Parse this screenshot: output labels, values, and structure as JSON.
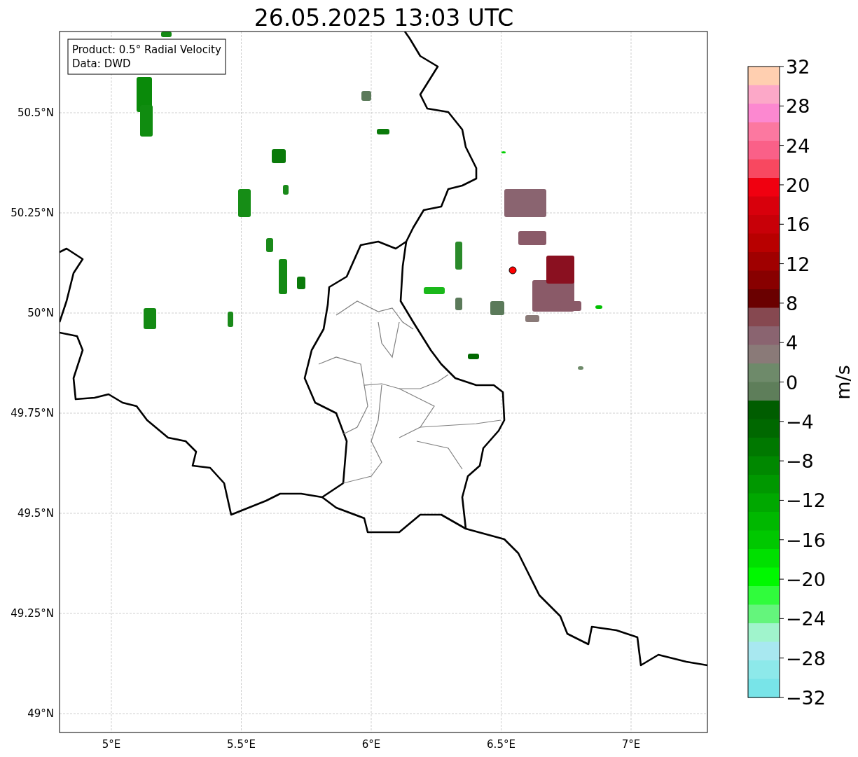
{
  "title": "26.05.2025 13:03 UTC",
  "info_box": {
    "lines": [
      "Product: 0.5° Radial Velocity",
      "Data: DWD"
    ]
  },
  "y_ticks": [
    "50.5°N",
    "50.25°N",
    "50°N",
    "49.75°N",
    "49.5°N",
    "49.25°N",
    "49°N"
  ],
  "x_ticks": [
    "5°E",
    "5.5°E",
    "6°E",
    "6.5°E",
    "7°E"
  ],
  "colorbar": {
    "label": "m/s",
    "ticks": [
      "32",
      "28",
      "24",
      "20",
      "16",
      "12",
      "8",
      "4",
      "0",
      "−4",
      "−8",
      "−12",
      "−16",
      "−20",
      "−24",
      "−28",
      "−32"
    ],
    "bins": [
      {
        "color": "#ffcfb0"
      },
      {
        "color": "#fca8c8"
      },
      {
        "color": "#fc88d0"
      },
      {
        "color": "#fc78a0"
      },
      {
        "color": "#fa6088"
      },
      {
        "color": "#f84860"
      },
      {
        "color": "#f00010"
      },
      {
        "color": "#d8000c"
      },
      {
        "color": "#c80008"
      },
      {
        "color": "#b80000"
      },
      {
        "color": "#a00000"
      },
      {
        "color": "#880000"
      },
      {
        "color": "#6a0000"
      },
      {
        "color": "#864850"
      },
      {
        "color": "#8a6470"
      },
      {
        "color": "#8a7a78"
      },
      {
        "color": "#6e8a6a"
      },
      {
        "color": "#5e7e5a"
      },
      {
        "color": "#005d00"
      },
      {
        "color": "#006800"
      },
      {
        "color": "#007800"
      },
      {
        "color": "#008800"
      },
      {
        "color": "#009800"
      },
      {
        "color": "#00a800"
      },
      {
        "color": "#00b800"
      },
      {
        "color": "#00c800"
      },
      {
        "color": "#00e000"
      },
      {
        "color": "#00f800"
      },
      {
        "color": "#30fc3c"
      },
      {
        "color": "#64f57c"
      },
      {
        "color": "#a0f4cc"
      },
      {
        "color": "#a8e8f0"
      },
      {
        "color": "#8de9ea"
      },
      {
        "color": "#78e4e8"
      }
    ]
  }
}
